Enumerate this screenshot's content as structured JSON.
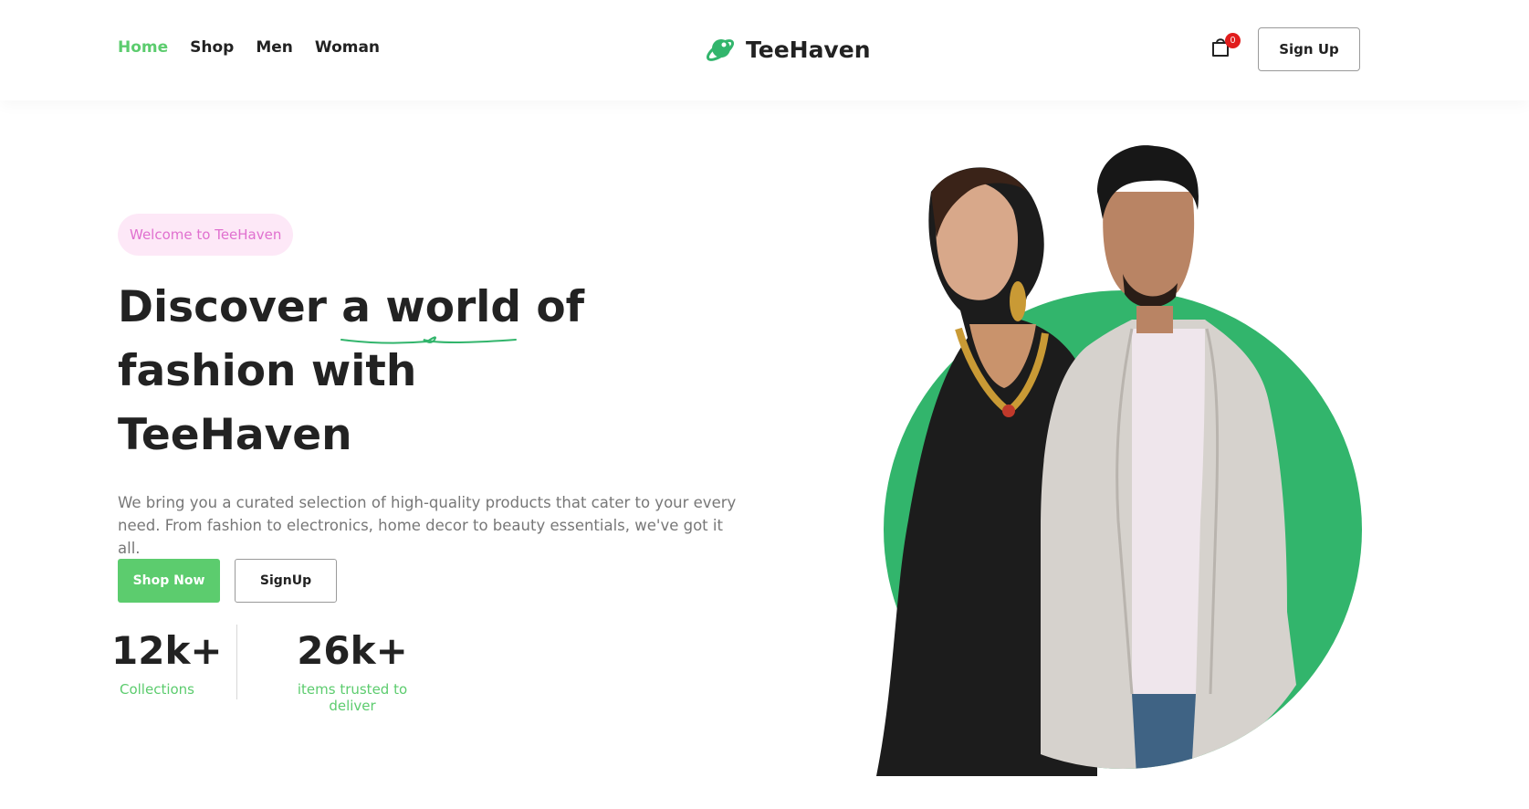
{
  "nav": {
    "links": [
      "Home",
      "Shop",
      "Men",
      "Woman"
    ],
    "active": "Home"
  },
  "brand": {
    "name": "TeeHaven",
    "logo_icon": "planet-logo-icon"
  },
  "header": {
    "cart_icon": "shopping-bag-icon",
    "cart_count": "0",
    "signup_label": "Sign Up"
  },
  "hero": {
    "welcome": "Welcome to TeeHaven",
    "title_line1": "Discover a world of",
    "title_line2": "fashion with",
    "title_line3": "TeeHaven",
    "description": "We bring you a curated selection of high-quality products that cater to your every need. From fashion to electronics, home decor to beauty essentials, we've got it all.",
    "shop_button": "Shop Now",
    "signup_button": "SignUp"
  },
  "stats": [
    {
      "value": "12k+",
      "label": "Collections"
    },
    {
      "value": "26k+",
      "label": "items trusted to deliver"
    }
  ],
  "colors": {
    "accent": "#5ccc6e",
    "circle": "#32b56c",
    "pill_bg": "#fde8f7",
    "pill_text": "#e070cf",
    "badge": "#e11d1d"
  }
}
